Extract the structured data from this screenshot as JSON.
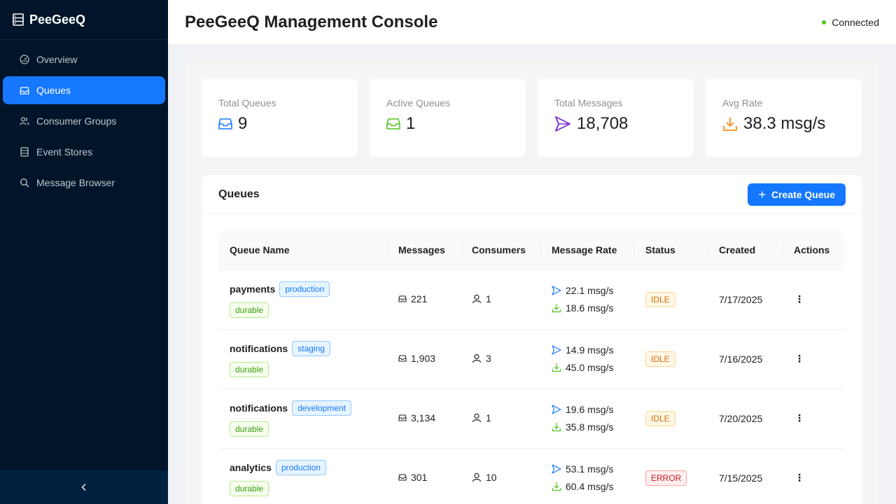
{
  "sidebar": {
    "brand": "PeeGeeQ",
    "items": [
      {
        "label": "Overview"
      },
      {
        "label": "Queues"
      },
      {
        "label": "Consumer Groups"
      },
      {
        "label": "Event Stores"
      },
      {
        "label": "Message Browser"
      }
    ]
  },
  "header": {
    "title": "PeeGeeQ Management Console",
    "status": "Connected"
  },
  "stats": [
    {
      "title": "Total Queues",
      "value": "9"
    },
    {
      "title": "Active Queues",
      "value": "1"
    },
    {
      "title": "Total Messages",
      "value": "18,708"
    },
    {
      "title": "Avg Rate",
      "value": "38.3 msg/s"
    }
  ],
  "queues": {
    "title": "Queues",
    "create_label": "Create Queue",
    "columns": [
      "Queue Name",
      "Messages",
      "Consumers",
      "Message Rate",
      "Status",
      "Created",
      "Actions"
    ],
    "rows": [
      {
        "name": "payments",
        "env": "production",
        "durable": "durable",
        "messages": "221",
        "consumers": "1",
        "rate_in": "22.1 msg/s",
        "rate_out": "18.6 msg/s",
        "status": "IDLE",
        "created": "7/17/2025"
      },
      {
        "name": "notifications",
        "env": "staging",
        "durable": "durable",
        "messages": "1,903",
        "consumers": "3",
        "rate_in": "14.9 msg/s",
        "rate_out": "45.0 msg/s",
        "status": "IDLE",
        "created": "7/16/2025"
      },
      {
        "name": "notifications",
        "env": "development",
        "durable": "durable",
        "messages": "3,134",
        "consumers": "1",
        "rate_in": "19.6 msg/s",
        "rate_out": "35.8 msg/s",
        "status": "IDLE",
        "created": "7/20/2025"
      },
      {
        "name": "analytics",
        "env": "production",
        "durable": "durable",
        "messages": "301",
        "consumers": "10",
        "rate_in": "53.1 msg/s",
        "rate_out": "60.4 msg/s",
        "status": "ERROR",
        "created": "7/15/2025"
      }
    ]
  },
  "colors": {
    "sidebar_bg": "#001529",
    "primary": "#1677ff",
    "success": "#52c41a",
    "warning": "#d46b08",
    "error": "#cf1322",
    "purple": "#722ed1",
    "orange": "#fa8c16"
  },
  "icons": {
    "brand": "database-icon",
    "overview": "dashboard-icon",
    "queues": "inbox-icon",
    "consumer_groups": "team-icon",
    "event_stores": "database-icon",
    "message_browser": "search-icon",
    "collapse": "chevron-left-icon"
  }
}
